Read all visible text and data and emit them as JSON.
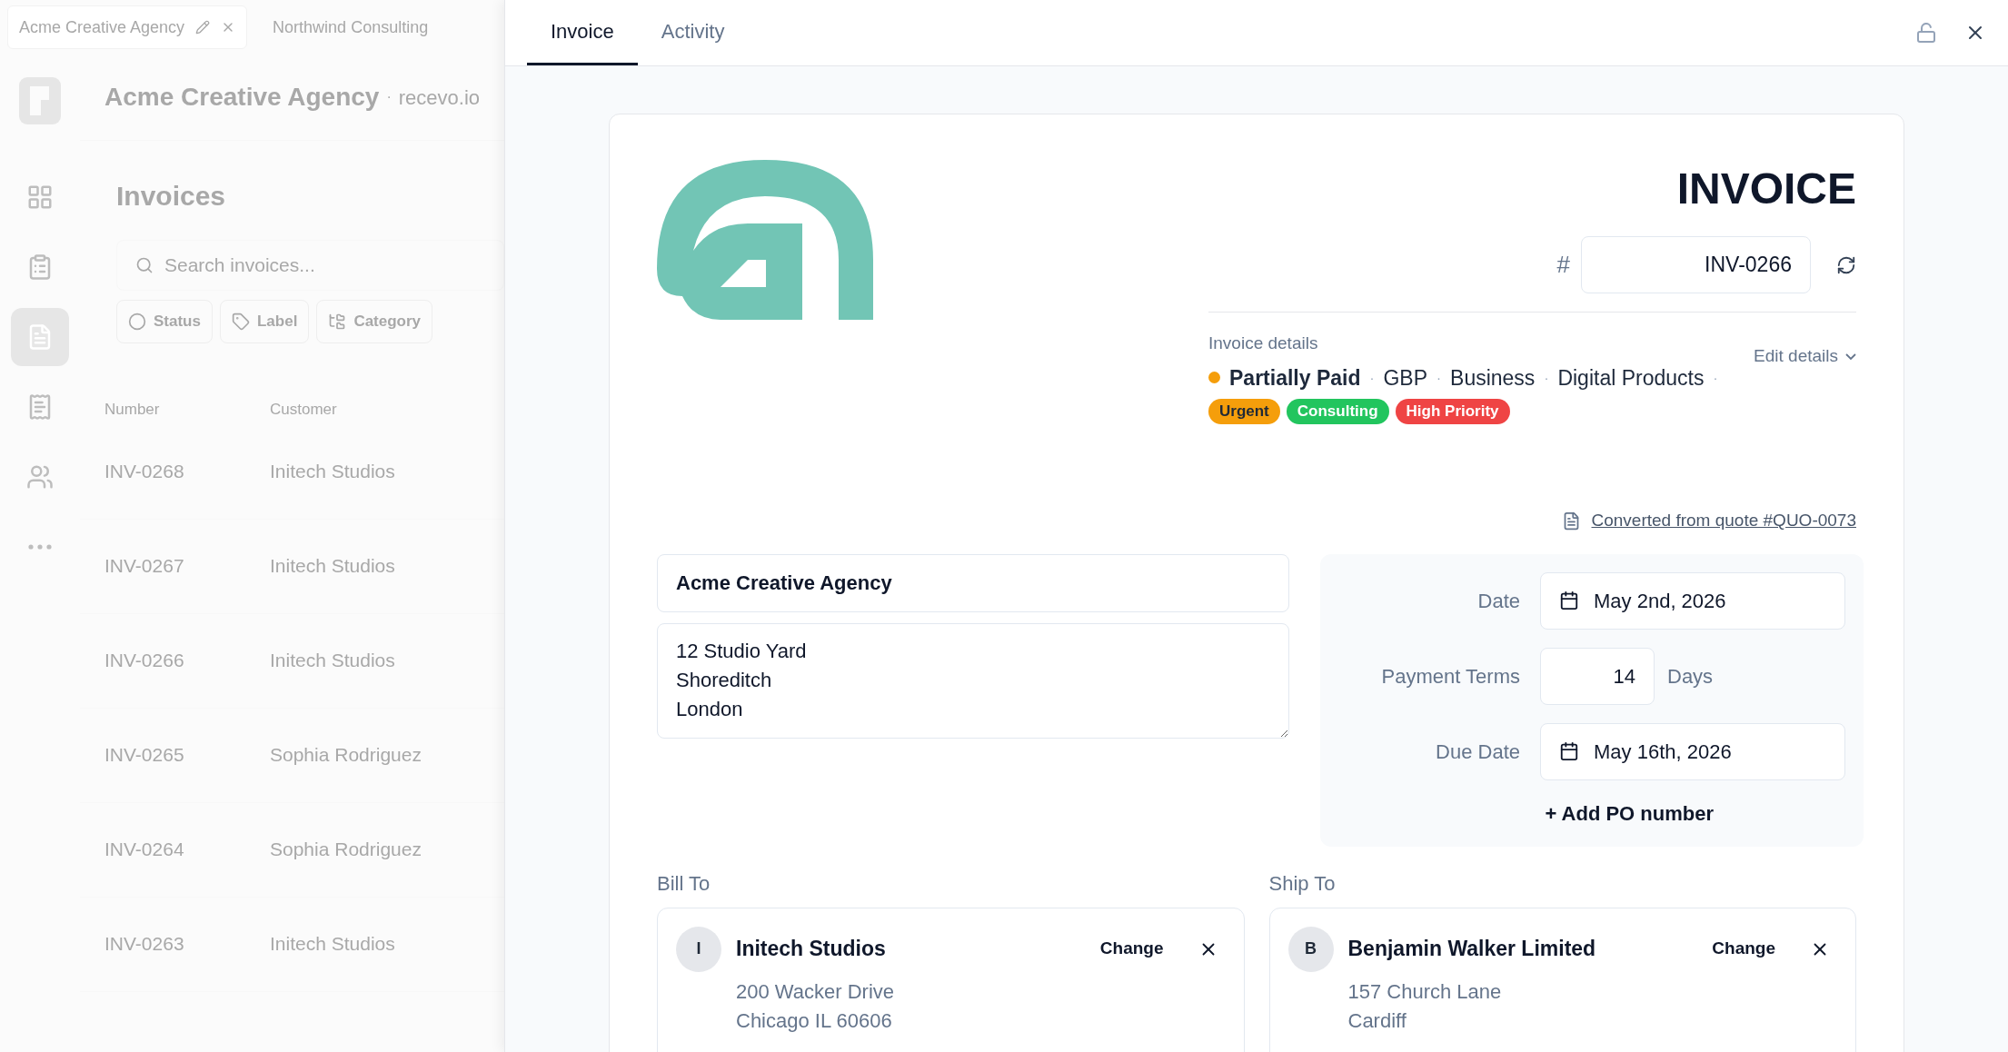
{
  "background": {
    "tabs": [
      {
        "label": "Acme Creative Agency",
        "selected": true
      },
      {
        "label": "Northwind Consulting",
        "selected": false
      }
    ],
    "nav": [
      {
        "kind": "dashboard",
        "selected": false
      },
      {
        "kind": "tasks",
        "selected": false
      },
      {
        "kind": "invoices",
        "selected": true
      },
      {
        "kind": "expenses",
        "selected": false
      },
      {
        "kind": "clients",
        "selected": false
      },
      {
        "kind": "more",
        "selected": false
      }
    ],
    "app_title": "Acme Creative Agency",
    "title_separator": "·",
    "domain": "recevo.io",
    "page_title": "Invoices",
    "search": {
      "placeholder": "Search invoices..."
    },
    "filters": [
      {
        "kind": "status",
        "label": "Status"
      },
      {
        "kind": "label",
        "label": "Label"
      },
      {
        "kind": "category",
        "label": "Category"
      }
    ],
    "columns": [
      "Number",
      "Customer"
    ],
    "rows": [
      {
        "number": "INV-0268",
        "customer": "Initech Studios"
      },
      {
        "number": "INV-0267",
        "customer": "Initech Studios"
      },
      {
        "number": "INV-0266",
        "customer": "Initech Studios"
      },
      {
        "number": "INV-0265",
        "customer": "Sophia Rodriguez"
      },
      {
        "number": "INV-0264",
        "customer": "Sophia Rodriguez"
      },
      {
        "number": "INV-0263",
        "customer": "Initech Studios"
      }
    ]
  },
  "drawer": {
    "tabs": [
      {
        "label": "Invoice",
        "selected": true
      },
      {
        "label": "Activity",
        "selected": false
      }
    ],
    "title": "INVOICE",
    "number_prefix": "#",
    "number": "INV-0266",
    "details_label": "Invoice details",
    "edit_details": "Edit details",
    "status": {
      "label": "Partially Paid",
      "color": "#f59e0b"
    },
    "separator": "·",
    "meta": [
      "GBP",
      "Business",
      "Digital Products"
    ],
    "tags": [
      {
        "label": "Urgent",
        "color": "#f59e0b"
      },
      {
        "label": "Consulting",
        "color": "#22c55e"
      },
      {
        "label": "High Priority",
        "color": "#ef4444"
      }
    ],
    "converted_link": "Converted from quote #QUO-0073",
    "from": {
      "name": "Acme Creative Agency",
      "address": "12 Studio Yard\nShoreditch\nLondon"
    },
    "dates": {
      "date_label": "Date",
      "date": "May 2nd, 2026",
      "terms_label": "Payment Terms",
      "terms": "14",
      "terms_unit": "Days",
      "due_label": "Due Date",
      "due": "May 16th, 2026",
      "add_po": "+ Add PO number"
    },
    "parties": [
      {
        "heading": "Bill To",
        "initial": "I",
        "name": "Initech Studios",
        "change": "Change",
        "address": [
          "200 Wacker Drive",
          "Chicago IL 60606"
        ]
      },
      {
        "heading": "Ship To",
        "initial": "B",
        "name": "Benjamin Walker Limited",
        "change": "Change",
        "address": [
          "157 Church Lane",
          "Cardiff"
        ]
      }
    ]
  }
}
